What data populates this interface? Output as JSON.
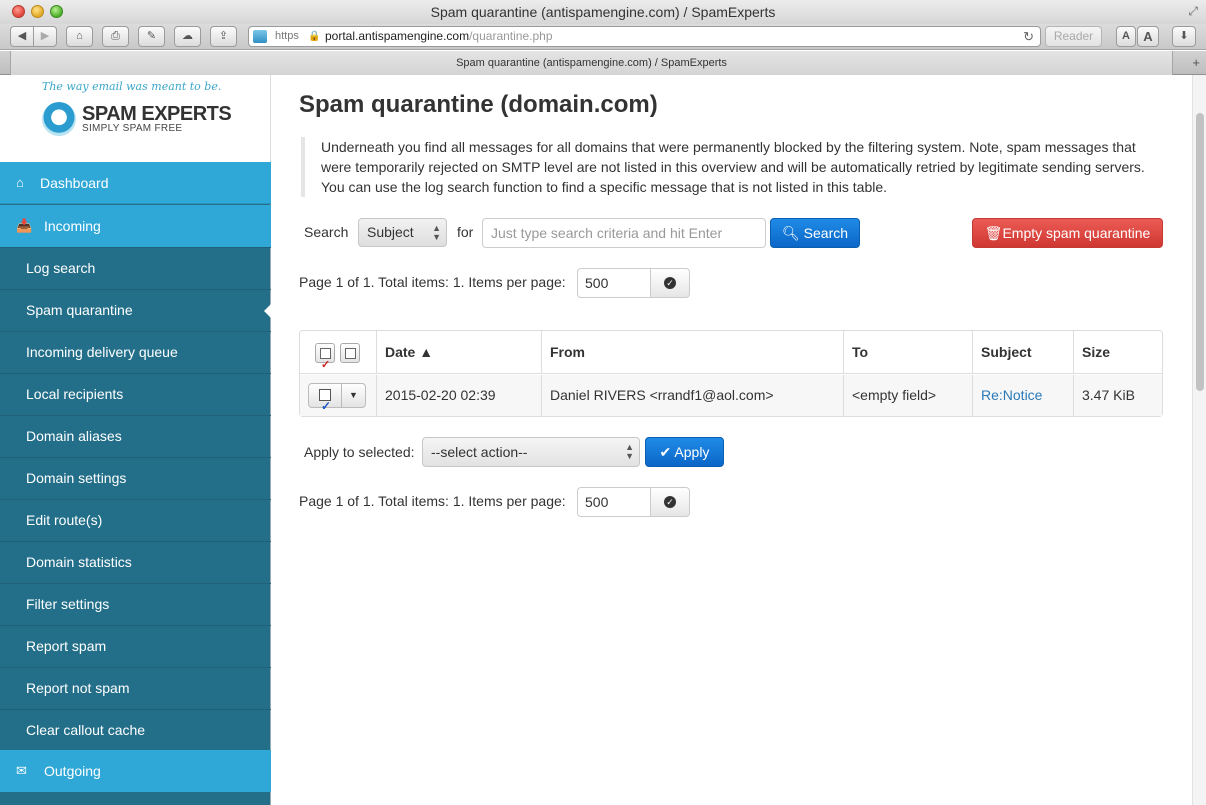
{
  "browser": {
    "window_title": "Spam quarantine (antispamengine.com) / SpamExperts",
    "address": {
      "scheme": "https",
      "host": "portal.antispamengine.com",
      "path": "/quarantine.php"
    },
    "reader_label": "Reader",
    "font_small": "A",
    "font_large": "A",
    "tab_title": "Spam quarantine (antispamengine.com) / SpamExperts"
  },
  "brand": {
    "tagline": "The way email was meant to be.",
    "name": "SPAM EXPERTS",
    "subtitle": "SIMPLY SPAM FREE"
  },
  "sidebar": {
    "dashboard": "Dashboard",
    "incoming": "Incoming",
    "items": [
      "Log search",
      "Spam quarantine",
      "Incoming delivery queue",
      "Local recipients",
      "Domain aliases",
      "Domain settings",
      "Edit route(s)",
      "Domain statistics",
      "Filter settings",
      "Report spam",
      "Report not spam",
      "Clear callout cache"
    ],
    "active_item": "Spam quarantine",
    "outgoing": "Outgoing"
  },
  "main": {
    "title": "Spam quarantine (domain.com)",
    "intro": "Underneath you find all messages for all domains that were permanently blocked by the filtering system. Note, spam messages that were temporarily rejected on SMTP level are not listed in this overview and will be automatically retried by legitimate sending servers. You can use the log search function to find a specific message that is not listed in this table.",
    "search_label": "Search",
    "search_field_value": "Subject",
    "for_label": "for",
    "search_placeholder": "Just type search criteria and hit Enter",
    "search_button": "Search",
    "empty_button": "Empty spam quarantine",
    "pager_text": "Page 1 of 1. Total items: 1. Items per page:",
    "items_per_page": "500",
    "table": {
      "headers": [
        "Date ▲",
        "From",
        "To",
        "Subject",
        "Size"
      ],
      "rows": [
        {
          "date": "2015-02-20 02:39",
          "from": "Daniel RIVERS <rrandf1@aol.com>",
          "to": "<empty field>",
          "subject": "Re:Notice",
          "size": "3.47 KiB"
        }
      ]
    },
    "apply_label": "Apply to selected:",
    "action_value": "--select action--",
    "apply_button": "Apply"
  }
}
